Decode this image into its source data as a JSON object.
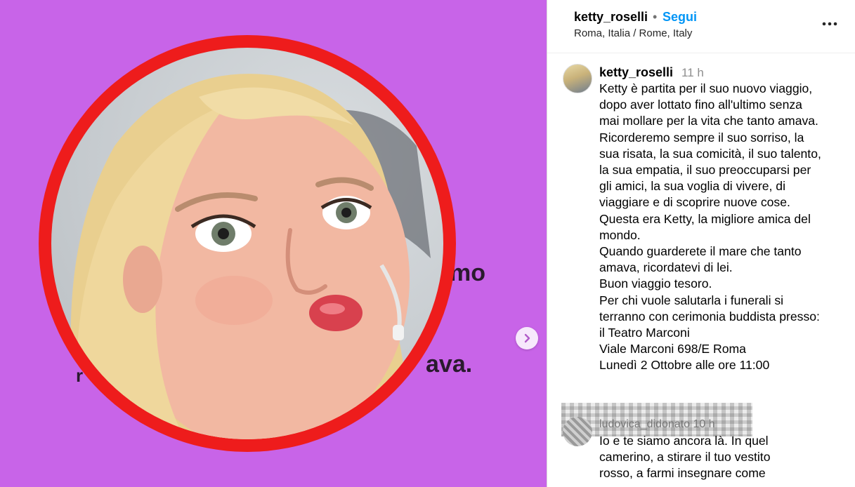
{
  "post": {
    "background_color": "#c864e8",
    "ring_color": "#ee1c1c",
    "overlay_text": [
      "mo",
      "ava.",
      "r"
    ],
    "next_icon": "chevron-right-icon"
  },
  "header": {
    "username": "ketty_roselli",
    "dot": "•",
    "follow_label": "Segui",
    "location": "Roma, Italia / Rome, Italy",
    "more_icon": "more-horizontal-icon"
  },
  "caption": {
    "username": "ketty_roselli",
    "time": "11 h",
    "text": "Ketty è partita per il suo nuovo viaggio,\ndopo aver lottato fino all'ultimo senza\nmai mollare per la vita che tanto amava.\nRicorderemo sempre il suo sorriso, la\nsua risata, la sua comicità, il suo talento,\nla sua empatia, il suo preoccuparsi per\ngli amici, la sua voglia di vivere, di\nviaggiare e di scoprire nuove cose.\nQuesta era Ketty, la migliore amica del\nmondo.\nQuando guarderete il mare che tanto\namava, ricordatevi di lei.\nBuon viaggio tesoro.\nPer chi vuole salutarla i funerali si\nterranno con cerimonia buddista presso:\nil Teatro Marconi\nViale Marconi 698/E Roma\nLunedì 2 Ottobre alle ore 11:00"
  },
  "comment": {
    "username": "ludovica_didonato 10 h",
    "text": "Io e te siamo ancora là. In quel\ncamerino, a stirare il tuo vestito\nrosso, a farmi insegnare come"
  },
  "colors": {
    "link": "#0095f6",
    "muted": "#8e8e8e"
  }
}
